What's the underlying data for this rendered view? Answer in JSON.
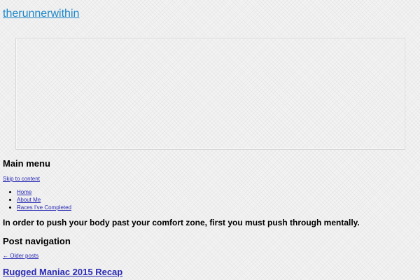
{
  "site": {
    "title": "therunnerwithin",
    "tagline": "In order to push your body past your comfort zone, first you must push through mentally."
  },
  "navigation": {
    "heading": "Main menu",
    "skip_link": "Skip to content",
    "items": [
      {
        "label": "Home"
      },
      {
        "label": "About Me"
      },
      {
        "label": "Races I've Completed"
      }
    ]
  },
  "post_navigation": {
    "heading": "Post navigation",
    "older_posts": "← Older posts"
  },
  "posts": [
    {
      "title": "Rugged Maniac 2015 Recap"
    }
  ],
  "colors": {
    "site_title": "#1e87c9",
    "link": "#2b2bb5",
    "background": "#f3f3f3"
  }
}
